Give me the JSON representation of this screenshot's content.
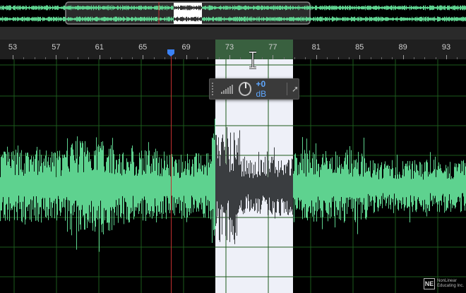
{
  "timeline": {
    "ruler_labels": [
      "53",
      "57",
      "61",
      "65",
      "69",
      "73",
      "77",
      "81",
      "85",
      "89",
      "93"
    ],
    "unit_step_seconds": 4
  },
  "gain_hud": {
    "value_number": "+0",
    "value_unit": "dB",
    "knob_icon": "volume-knob-icon",
    "meter_icon": "level-meter-icon",
    "pin_icon": "pin-icon"
  },
  "logo": {
    "mark": "NE",
    "line1": "NonLinear",
    "line2": "Educating Inc."
  },
  "colors": {
    "waveform": "#5ed28f",
    "waveform_selected": "#3a3d40",
    "selection_bg": "#eef0f8",
    "selection_ruler": "#39603f",
    "grid": "#1d5a1d",
    "playhead": "#c23030",
    "playhead_marker": "#3b82f6",
    "hud_value": "#5ea7ff"
  }
}
